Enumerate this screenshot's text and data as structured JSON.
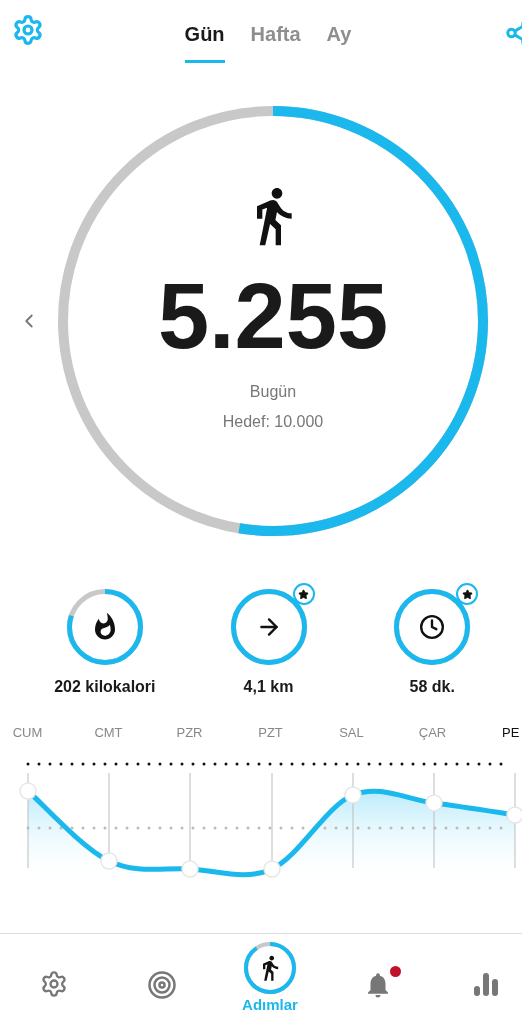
{
  "tabs": [
    {
      "label": "Gün",
      "selected": true
    },
    {
      "label": "Hafta",
      "selected": false
    },
    {
      "label": "Ay",
      "selected": false
    }
  ],
  "steps": {
    "value": "5.255",
    "caption": "Bugün",
    "goal": "Hedef: 10.000",
    "level": 0.5255
  },
  "stats": [
    {
      "kind": "calories",
      "label": "202 kilokalori",
      "level": 0.8,
      "achieved": false
    },
    {
      "kind": "distance",
      "label": "4,1 km",
      "level": 1,
      "achieved": true
    },
    {
      "kind": "time",
      "label": "58 dk.",
      "level": 1,
      "achieved": true
    }
  ],
  "days": [
    {
      "label": "CUM",
      "selected": false
    },
    {
      "label": "CMT",
      "selected": false
    },
    {
      "label": "PZR",
      "selected": false
    },
    {
      "label": "PZT",
      "selected": false
    },
    {
      "label": "SAL",
      "selected": false
    },
    {
      "label": "ÇAR",
      "selected": false
    },
    {
      "label": "PE",
      "selected": true
    }
  ],
  "nav": [
    {
      "kind": "settings",
      "selected": false
    },
    {
      "kind": "goals",
      "selected": false
    },
    {
      "kind": "steps",
      "label": "Adımlar",
      "selected": true
    },
    {
      "kind": "notifications",
      "selected": false,
      "badge": true
    },
    {
      "kind": "stats",
      "selected": false
    }
  ]
}
